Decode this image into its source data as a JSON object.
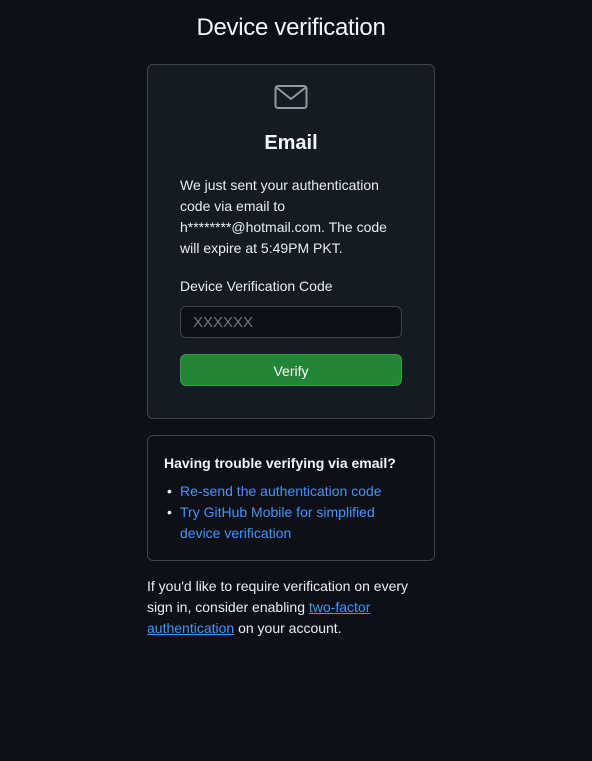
{
  "page": {
    "title": "Device verification"
  },
  "verification_card": {
    "icon": "mail-icon",
    "heading": "Email",
    "message": "We just sent your authentication code via email to h********@hotmail.com. The code will expire at 5:49PM PKT.",
    "field_label": "Device Verification Code",
    "code_input": {
      "value": "",
      "placeholder": "XXXXXX"
    },
    "verify_label": "Verify"
  },
  "help_card": {
    "heading": "Having trouble verifying via email?",
    "links": [
      {
        "label": "Re-send the authentication code"
      },
      {
        "label": "Try GitHub Mobile for simplified device verification"
      }
    ]
  },
  "footer": {
    "text_before": "If you'd like to require verification on every sign in, consider enabling ",
    "link_label": "two-factor authentication",
    "text_after": " on your account."
  },
  "colors": {
    "background": "#0d1117",
    "card_background": "#151b23",
    "border": "#3d444d",
    "primary_button": "#238636",
    "link": "#4493f8"
  }
}
